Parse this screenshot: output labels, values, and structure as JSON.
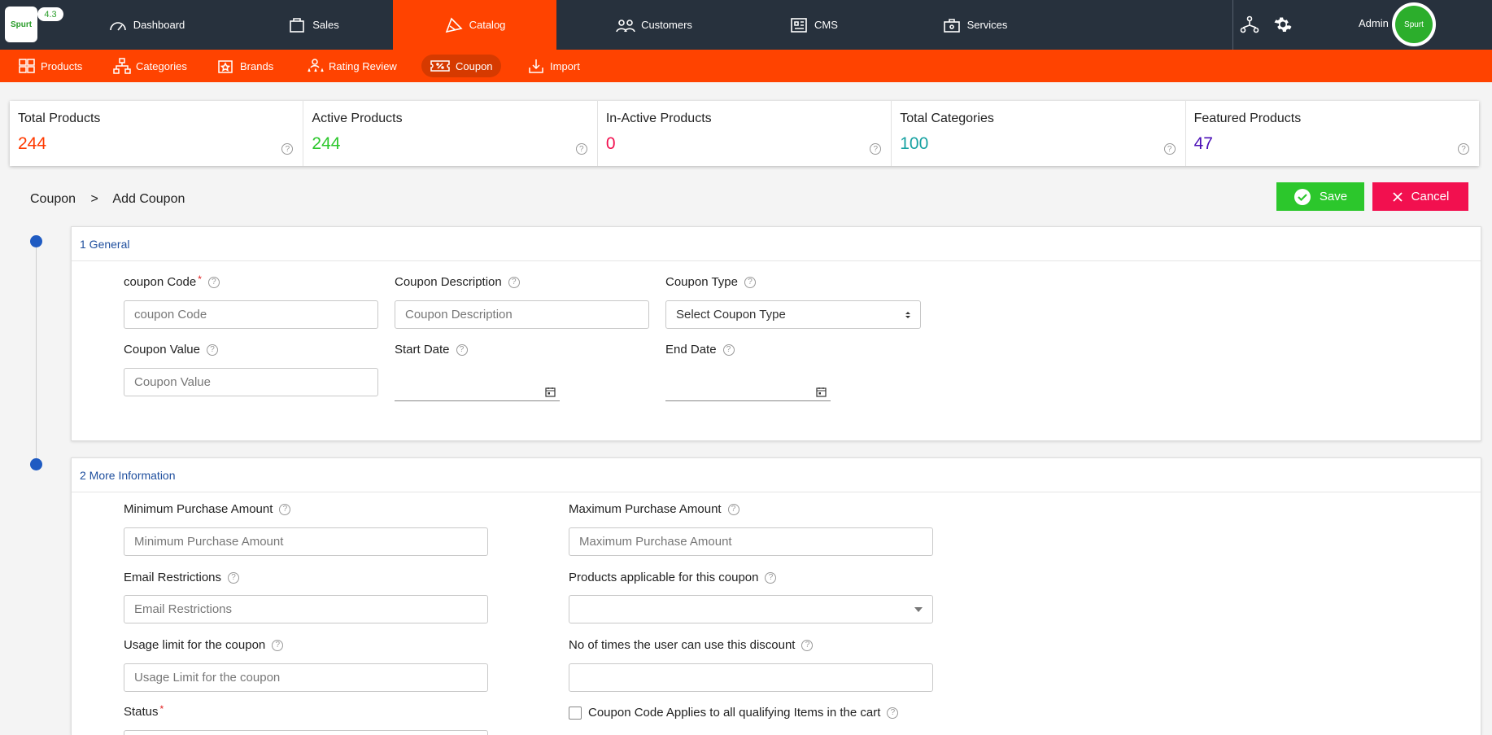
{
  "app": {
    "version": "4.3",
    "logo_text": "Spurt",
    "user": "Admin",
    "avatar_text": "Spurt"
  },
  "nav": [
    {
      "label": "Dashboard",
      "icon": "dashboard-icon"
    },
    {
      "label": "Sales",
      "icon": "sales-icon"
    },
    {
      "label": "Catalog",
      "icon": "catalog-icon",
      "active": true
    },
    {
      "label": "Customers",
      "icon": "customers-icon"
    },
    {
      "label": "CMS",
      "icon": "cms-icon"
    },
    {
      "label": "Services",
      "icon": "services-icon"
    }
  ],
  "subnav": [
    {
      "label": "Products"
    },
    {
      "label": "Categories"
    },
    {
      "label": "Brands"
    },
    {
      "label": "Rating Review"
    },
    {
      "label": "Coupon",
      "active": true
    },
    {
      "label": "Import"
    }
  ],
  "stats": [
    {
      "label": "Total Products",
      "value": "244",
      "color": "#ff3a00"
    },
    {
      "label": "Active Products",
      "value": "244",
      "color": "#2cc72c"
    },
    {
      "label": "In-Active Products",
      "value": "0",
      "color": "#f2104f"
    },
    {
      "label": "Total Categories",
      "value": "100",
      "color": "#17a2a2"
    },
    {
      "label": "Featured Products",
      "value": "47",
      "color": "#4b0fb7"
    }
  ],
  "breadcrumb": {
    "root": "Coupon",
    "sep": ">",
    "current": "Add Coupon"
  },
  "actions": {
    "save": "Save",
    "cancel": "Cancel"
  },
  "general": {
    "title": "1 General",
    "code_label": "coupon Code",
    "code_placeholder": "coupon Code",
    "desc_label": "Coupon Description",
    "desc_placeholder": "Coupon Description",
    "type_label": "Coupon Type",
    "type_value": "Select Coupon Type",
    "value_label": "Coupon Value",
    "value_placeholder": "Coupon Value",
    "start_label": "Start Date",
    "end_label": "End Date"
  },
  "more": {
    "title": "2 More Information",
    "min_label": "Minimum Purchase Amount",
    "min_placeholder": "Minimum Purchase Amount",
    "max_label": "Maximum Purchase Amount",
    "max_placeholder": "Maximum Purchase Amount",
    "email_label": "Email Restrictions",
    "email_placeholder": "Email Restrictions",
    "products_label": "Products applicable for this coupon",
    "usage_label": "Usage limit for the coupon",
    "usage_placeholder": "Usage Limit for the coupon",
    "times_label": "No of times the user can use this discount",
    "status_label": "Status",
    "applies_label": "Coupon Code Applies to all qualifying Items in the cart"
  },
  "help_glyph": "?",
  "required_glyph": "*"
}
